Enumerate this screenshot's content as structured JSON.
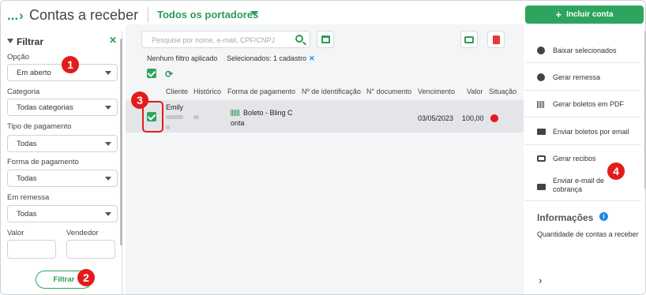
{
  "header": {
    "dots": "...",
    "title": "Contas a receber",
    "filter_label": "Todos os portadores",
    "add_button_label": "Incluir conta",
    "add_button_icon": "+"
  },
  "filters": {
    "title": "Filtrar",
    "close_icon": "✕",
    "opcao_label": "Opção",
    "opcao_value": "Em aberto",
    "categoria_label": "Categoria",
    "categoria_value": "Todas categorias",
    "tipo_label": "Tipo de pagamento",
    "tipo_value": "Todas",
    "forma_label": "Forma de pagamento",
    "forma_value": "Todas",
    "remessa_label": "Em remessa",
    "remessa_value": "Todas",
    "valor_label": "Valor",
    "vendedor_label": "Vendedor",
    "filter_button": "Filtrar"
  },
  "toolbar": {
    "search_placeholder": "Pesquise por nome, e-mail, CPF/CNPJ",
    "no_filter_text": "Nenhum filtro aplicado",
    "selected_text": "Selecionados: 1 cadastro",
    "selected_clear": "✕",
    "refresh_icon": "⟳"
  },
  "table": {
    "columns": [
      "Cliente",
      "Histórico",
      "Forma de pagamento",
      "Nº de identificação",
      "N° documento",
      "Vencimento",
      "Valor",
      "Situação"
    ],
    "rows": [
      {
        "cliente": "Emily",
        "forma_line1": "Boleto - Bling C",
        "forma_line2": "onta",
        "vencimento": "03/05/2023",
        "valor": "100,00",
        "situacao_color": "#e31b1b"
      }
    ]
  },
  "actions": {
    "items": [
      {
        "label": "Baixar selecionados",
        "icon": "check-circle-icon"
      },
      {
        "label": "Gerar remessa",
        "icon": "arrow-circle-icon"
      },
      {
        "label": "Gerar boletos em PDF",
        "icon": "barcode-icon"
      },
      {
        "label": "Enviar boletos por email",
        "icon": "mail-icon"
      },
      {
        "label": "Gerar recibos",
        "icon": "printer-icon"
      },
      {
        "label_line1": "Enviar e-mail de",
        "label_line2": "cobrança",
        "icon": "mail-icon"
      }
    ],
    "info_title": "Informações",
    "info_icon": "i",
    "info_text": "Quantidade de contas a receber",
    "chevron": "›"
  },
  "callouts": [
    "1",
    "2",
    "3",
    "4"
  ],
  "colors": {
    "accent": "#2ea55f",
    "danger": "#e31b1b",
    "link": "#1e88e5"
  }
}
